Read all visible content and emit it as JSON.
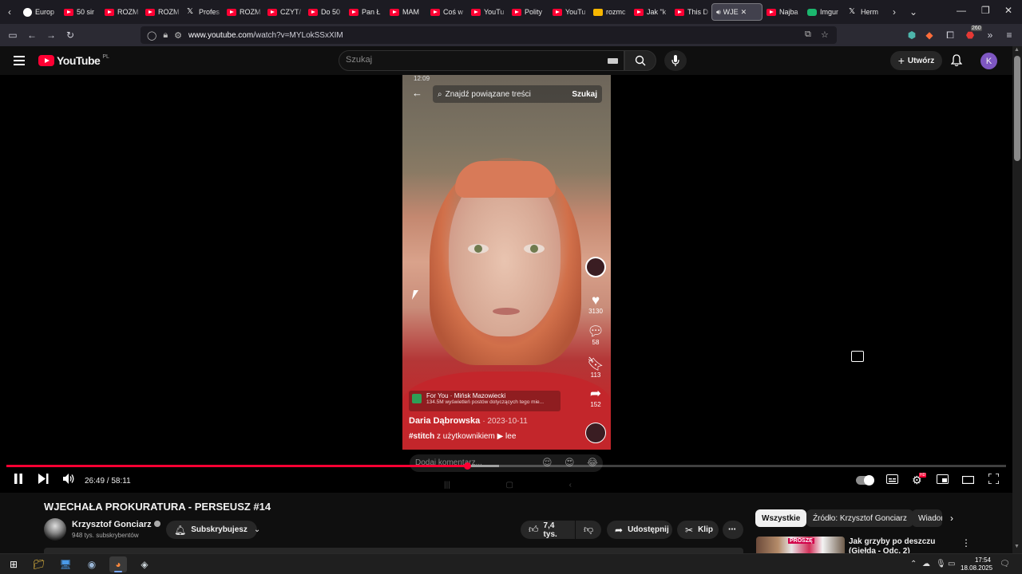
{
  "browser": {
    "tabs": [
      {
        "label": "Europ",
        "icon": "europe-globe-icon"
      },
      {
        "label": "50 sir",
        "icon": "youtube-icon"
      },
      {
        "label": "ROZM",
        "icon": "youtube-icon"
      },
      {
        "label": "ROZM",
        "icon": "youtube-icon"
      },
      {
        "label": "Profes",
        "icon": "x-icon"
      },
      {
        "label": "ROZM",
        "icon": "youtube-icon"
      },
      {
        "label": "CZYT/",
        "icon": "youtube-icon"
      },
      {
        "label": "Do 50",
        "icon": "youtube-icon"
      },
      {
        "label": "Pan Ł",
        "icon": "youtube-icon"
      },
      {
        "label": "MAM",
        "icon": "youtube-icon"
      },
      {
        "label": "Coś w",
        "icon": "youtube-icon"
      },
      {
        "label": "YouTu",
        "icon": "youtube-icon"
      },
      {
        "label": "Polity",
        "icon": "youtube-icon"
      },
      {
        "label": "YouTu",
        "icon": "youtube-icon"
      },
      {
        "label": "rozmc",
        "icon": "jp-icon"
      },
      {
        "label": "Jak \"k",
        "icon": "youtube-icon"
      },
      {
        "label": "This D",
        "icon": "youtube-icon"
      },
      {
        "label": "WJE",
        "icon": "speaker-icon",
        "active": true
      },
      {
        "label": "Najba",
        "icon": "youtube-icon"
      },
      {
        "label": "Imgur",
        "icon": "imgur-icon"
      },
      {
        "label": "Herm",
        "icon": "x-icon"
      }
    ],
    "url_domain": "www.youtube.com",
    "url_path": "/watch?v=MYLokSSxXIM",
    "ext_badge": "260"
  },
  "youtube": {
    "logo_text": "YouTube",
    "logo_region": "PL",
    "search_placeholder": "Szukaj",
    "create_label": "Utwórz",
    "avatar_letter": "K",
    "accent_color": "#ff0033"
  },
  "video": {
    "overlay": {
      "status_time": "12:09",
      "search_query": "Znajdź powiązane treści",
      "search_button": "Szukaj",
      "likes": "3130",
      "comments": "58",
      "saves": "113",
      "shares": "152",
      "foryou_label": "For You · Mińsk Mazowiecki",
      "foryou_sub": "134.5M wyświetleń postów dotyczących tego mie...",
      "author": "Daria Dąbrowska",
      "date": "· 2023-10-11",
      "stitch_tag": "#stitch",
      "stitch_text": "z użytkownikiem ▶ lee",
      "comment_placeholder": "Dodaj komentarz..."
    },
    "current_time": "26:49",
    "duration": "58:11",
    "progress_played": 0.461,
    "progress_loaded": 0.493,
    "hd_badge": "HD"
  },
  "info": {
    "title": "WJECHAŁA PROKURATURA - PERSEUSZ #14",
    "channel_name": "Krzysztof Gonciarz",
    "subscribers": "948 tys. subskrybentów",
    "subscribe_label": "Subskrybujesz",
    "likes": "7,4 tys.",
    "share_label": "Udostępnij",
    "clip_label": "Klip"
  },
  "sidebar": {
    "chips": [
      "Wszystkie",
      "Źródło: Krzysztof Gonciarz",
      "Wiadomości"
    ],
    "rec_title": "Jak grzyby po deszczu (Giełda - Odc. 2)",
    "rec_thumb_text": "PROSZĘ"
  },
  "taskbar": {
    "time": "17:54",
    "date": "18.08.2025"
  }
}
